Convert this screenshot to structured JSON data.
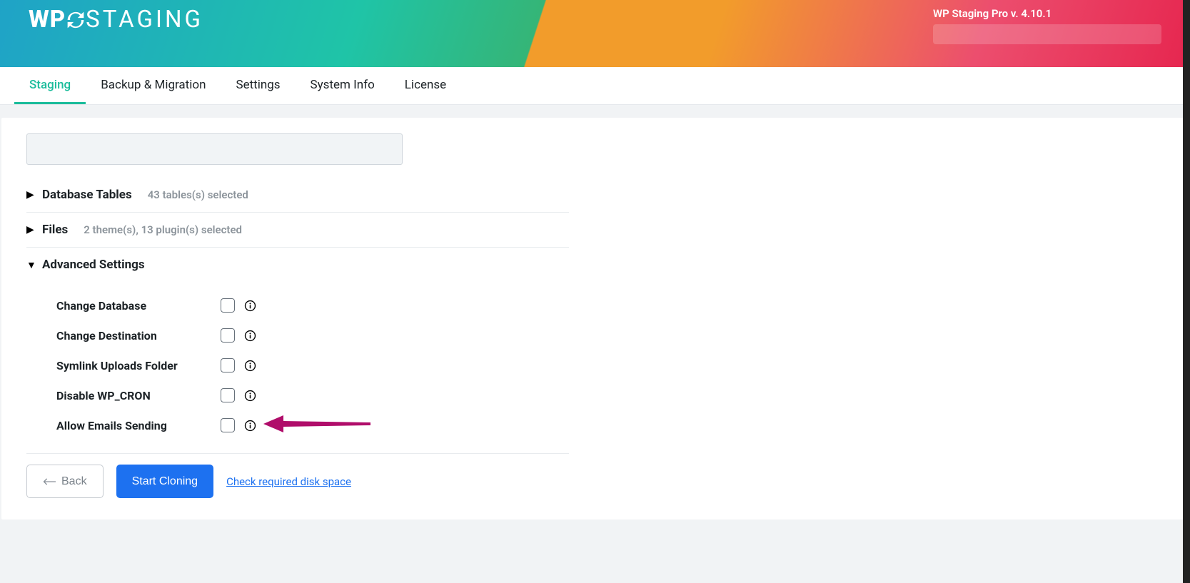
{
  "header": {
    "logo_pre": "WP",
    "logo_post": "STAGING",
    "version_line": "WP Staging Pro v. 4.10.1"
  },
  "tabs": {
    "staging": "Staging",
    "backup": "Backup & Migration",
    "settings": "Settings",
    "system_info": "System Info",
    "license": "License"
  },
  "sections": {
    "db_tables": {
      "title": "Database Tables",
      "sub": "43 tables(s) selected"
    },
    "files": {
      "title": "Files",
      "sub": "2 theme(s), 13 plugin(s) selected"
    },
    "advanced": {
      "title": "Advanced Settings"
    }
  },
  "advanced_options": {
    "change_database": "Change Database",
    "change_destination": "Change Destination",
    "symlink_uploads": "Symlink Uploads Folder",
    "disable_wp_cron": "Disable WP_CRON",
    "allow_emails": "Allow Emails Sending"
  },
  "actions": {
    "back": "Back",
    "start_cloning": "Start Cloning",
    "check_disk": "Check required disk space"
  }
}
